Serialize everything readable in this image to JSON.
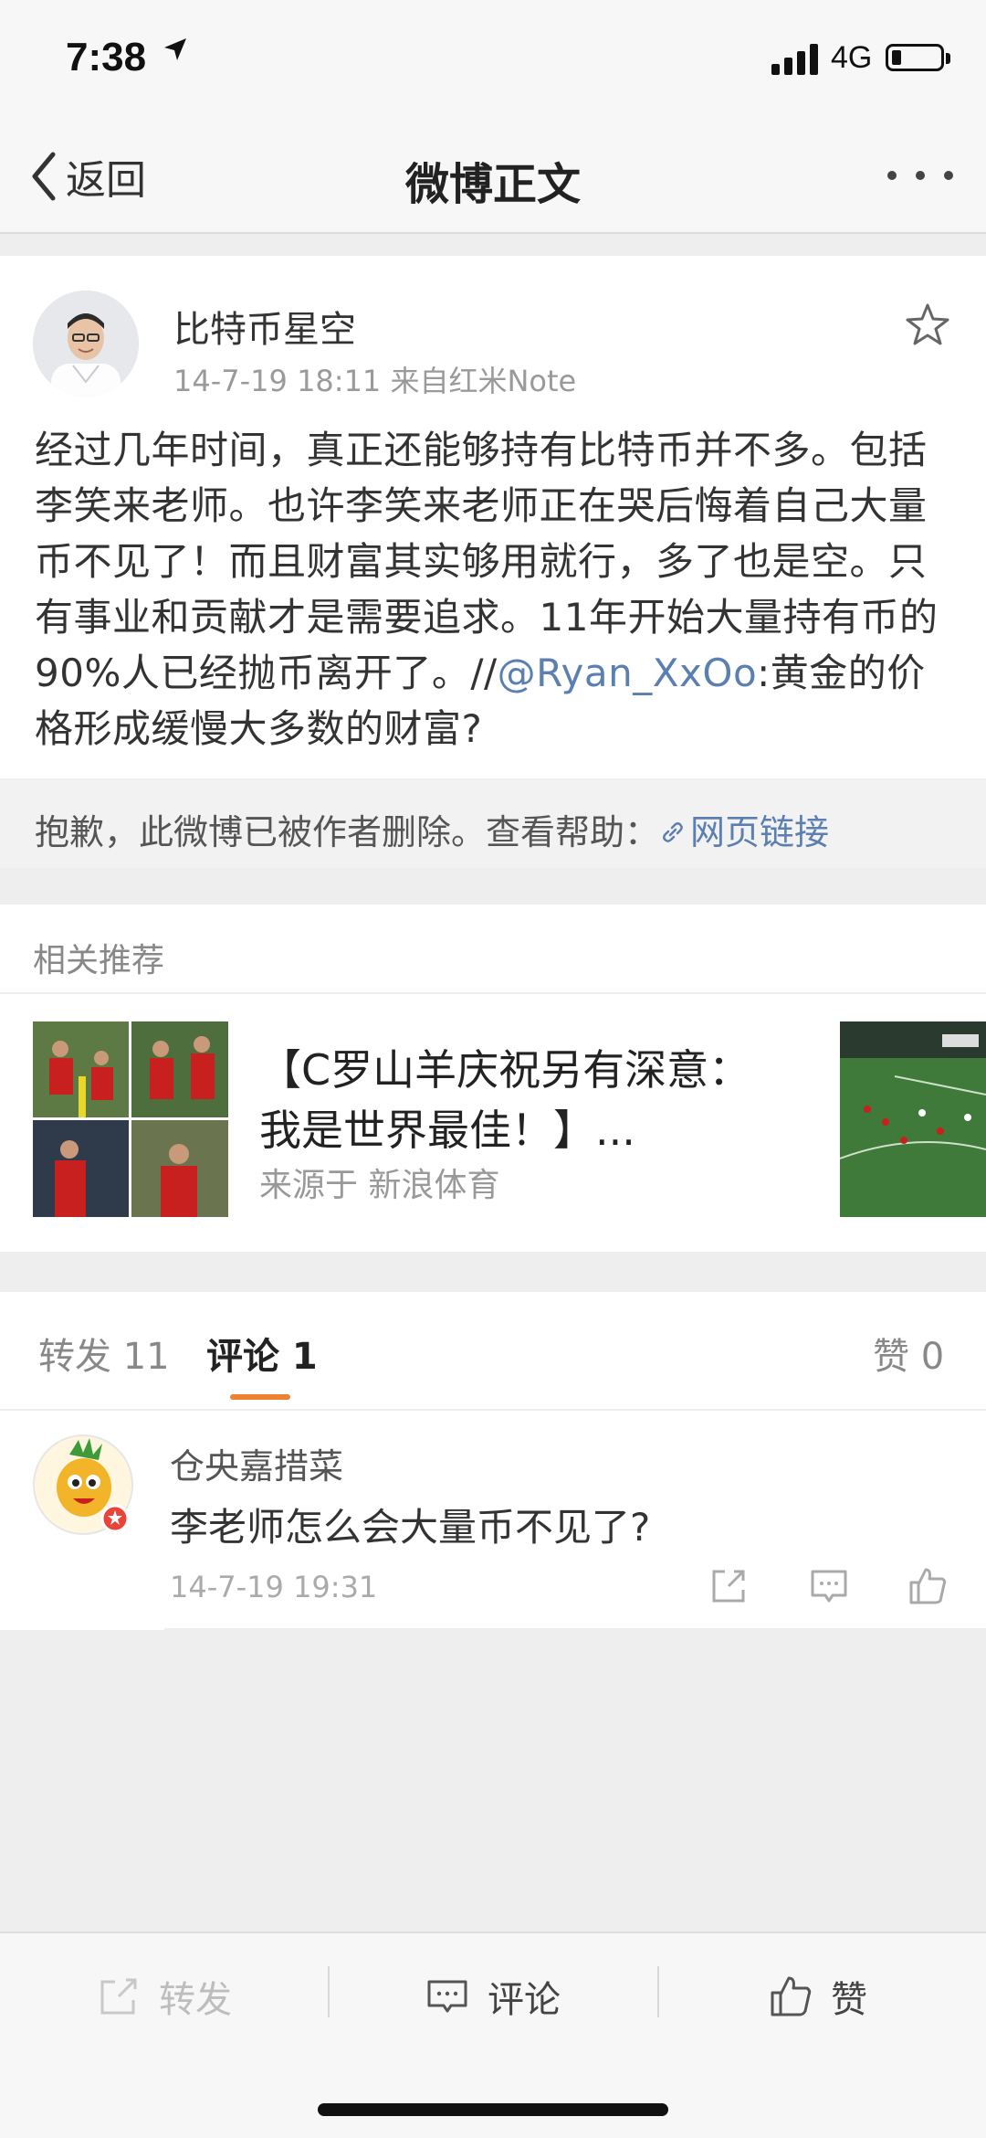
{
  "status_bar": {
    "time": "7:38",
    "network": "4G",
    "battery_level": 0.12
  },
  "nav": {
    "back_label": "返回",
    "title": "微博正文",
    "more_icon": "more-dots-icon"
  },
  "post": {
    "author": "比特币星空",
    "meta": "14-7-19 18:11  来自红米Note",
    "text_before": "经过几年时间，真正还能够持有比特币并不多。包括李笑来老师。也许李笑来老师正在哭后悔着自己大量币不见了！而且财富其实够用就行，多了也是空。只有事业和贡献才是需要追求。11年开始大量持有币的90%人已经抛币离开了。//",
    "mention": "@Ryan_XxOo",
    "text_after": ":黄金的价格形成缓慢大多数的财富?",
    "deleted_notice": "抱歉，此微博已被作者删除。查看帮助：",
    "help_link": "网页链接"
  },
  "related": {
    "heading": "相关推荐",
    "item": {
      "title": "【C罗山羊庆祝另有深意：我是世界最佳！】...",
      "source": "来源于 新浪体育"
    }
  },
  "tabs": {
    "repost": "转发 11",
    "comment": "评论 1",
    "like": "赞 0"
  },
  "comment": {
    "name": "仓央嘉措菜",
    "text": "李老师怎么会大量币不见了?",
    "time": "14-7-19 19:31"
  },
  "toolbar": {
    "repost": "转发",
    "comment": "评论",
    "like": "赞"
  },
  "colors": {
    "accent_orange": "#f08030",
    "link_blue": "#5a7fb0"
  }
}
